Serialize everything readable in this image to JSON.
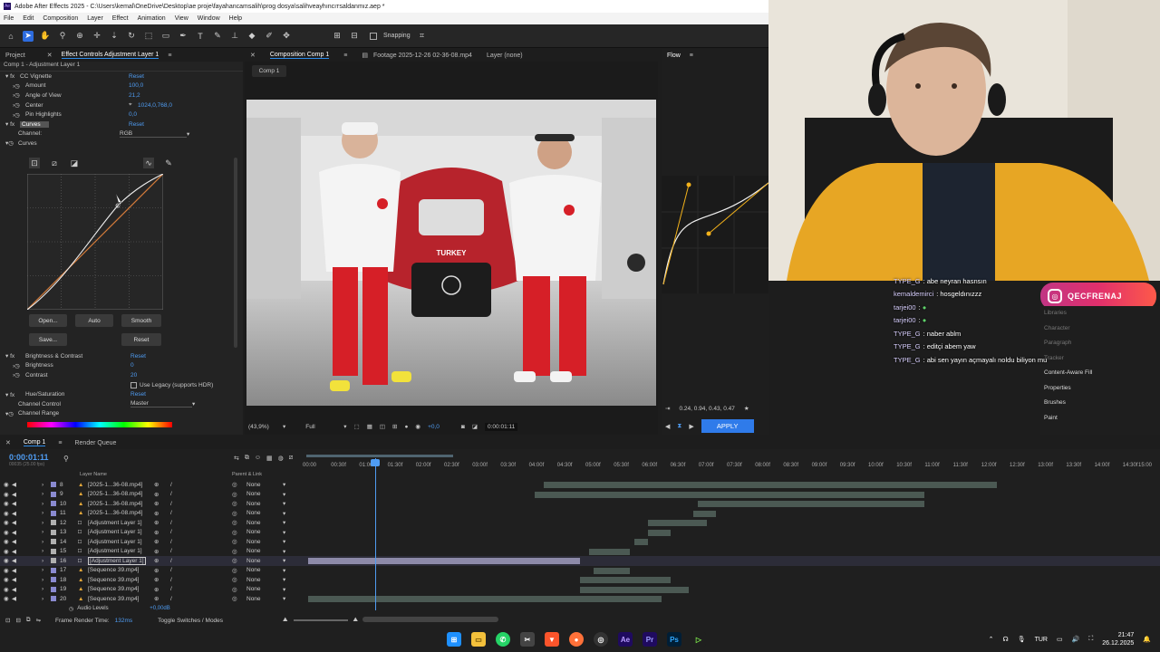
{
  "window": {
    "title": "Adobe After Effects 2025 - C:\\Users\\kemal\\OneDrive\\Desktop\\ae proje\\fayahancamsalih\\prog dosya\\salihveayhıncıтsaldanmız.aep *",
    "menu": [
      "File",
      "Edit",
      "Composition",
      "Layer",
      "Effect",
      "Animation",
      "View",
      "Window",
      "Help"
    ]
  },
  "toolbar": {
    "snapping_label": "Snapping"
  },
  "project_panel": {
    "tabs": [
      "Project",
      "Effect Controls Adjustment Layer 1"
    ],
    "subtitle": "Comp 1 - Adjustment Layer 1",
    "rows": [
      {
        "label": "CC Vignette",
        "value": "Reset"
      },
      {
        "label": "Amount",
        "value": "100,0"
      },
      {
        "label": "Angle of View",
        "value": "21,2"
      },
      {
        "label": "Center",
        "value": "1024,0,768,0"
      },
      {
        "label": "Pin Highlights",
        "value": "0,0"
      },
      {
        "label": "Curves",
        "value": "Reset"
      },
      {
        "label": "Channel:",
        "value": "RGB"
      },
      {
        "label": "Curves",
        "value": ""
      }
    ],
    "curve_buttons": [
      "Open...",
      "Auto",
      "Smooth",
      "Save...",
      "Reset"
    ],
    "rows2": [
      {
        "label": "Brightness & Contrast",
        "value": "Reset"
      },
      {
        "label": "Brightness",
        "value": "0"
      },
      {
        "label": "Contrast",
        "value": "20"
      },
      {
        "label": "Use Legacy (supports HDR)",
        "value": ""
      },
      {
        "label": "Hue/Saturation",
        "value": "Reset"
      },
      {
        "label": "Channel Control",
        "value": "Master"
      },
      {
        "label": "Channel Range",
        "value": ""
      }
    ]
  },
  "comp_panel": {
    "tabs": [
      "Composition Comp 1",
      "Footage 2025-12-26 02-36-08.mp4",
      "Layer (none)"
    ],
    "comp_tab": "Comp 1",
    "zoom": "(43,9%)",
    "resolution": "Full",
    "exposure": "+0,0",
    "timecode": "0:00:01:11"
  },
  "flow_panel": {
    "title": "Flow",
    "values": "0.24, 0.94, 0.43, 0.47",
    "apply_label": "APPLY"
  },
  "right_panel": {
    "items": [
      "Libraries",
      "Character",
      "Paragraph",
      "Tracker",
      "Content-Aware Fill",
      "Properties",
      "Brushes",
      "Paint"
    ]
  },
  "instagram": {
    "handle": "QECFRENAJ"
  },
  "chat": [
    {
      "user": "TYPE_G",
      "msg": "abe neyran hasnsın"
    },
    {
      "user": "kemaldemirci",
      "msg": "hosgeldınızzz"
    },
    {
      "user": "tarjei00",
      "msg": ""
    },
    {
      "user": "tarjei00",
      "msg": ""
    },
    {
      "user": "TYPE_G",
      "msg": "naber ablm"
    },
    {
      "user": "TYPE_G",
      "msg": "editçi abem yaw"
    },
    {
      "user": "TYPE_G",
      "msg": "abi sen yayın açmayalı noldu biliyon mu"
    }
  ],
  "timeline": {
    "tabs": [
      "Comp 1",
      "Render Queue"
    ],
    "timecode": "0:00:01:11",
    "frame_info": "00035 (25.00 fps)",
    "columns": [
      "Layer Name",
      "Parent & Link"
    ],
    "ruler": [
      "00:00",
      "00:30f",
      "01:00f",
      "01:30f",
      "02:00f",
      "02:30f",
      "03:00f",
      "03:30f",
      "04:00f",
      "04:30f",
      "05:00f",
      "05:30f",
      "06:00f",
      "06:30f",
      "07:00f",
      "07:30f",
      "08:00f",
      "08:30f",
      "09:00f",
      "09:30f",
      "10:00f",
      "10:30f",
      "11:00f",
      "11:30f",
      "12:00f",
      "12:30f",
      "13:00f",
      "13:30f",
      "14:00f",
      "14:30f",
      "15:00"
    ],
    "layers": [
      {
        "num": "8",
        "name": "[2025-1...36-08.mp4]",
        "parent": "None"
      },
      {
        "num": "9",
        "name": "[2025-1...36-08.mp4]",
        "parent": "None"
      },
      {
        "num": "10",
        "name": "[2025-1...36-08.mp4]",
        "parent": "None"
      },
      {
        "num": "11",
        "name": "[2025-1...36-08.mp4]",
        "parent": "None"
      },
      {
        "num": "12",
        "name": "[Adjustment Layer 1]",
        "parent": "None"
      },
      {
        "num": "13",
        "name": "[Adjustment Layer 1]",
        "parent": "None"
      },
      {
        "num": "14",
        "name": "[Adjustment Layer 1]",
        "parent": "None"
      },
      {
        "num": "15",
        "name": "[Adjustment Layer 1]",
        "parent": "None"
      },
      {
        "num": "16",
        "name": "[Adjustment Layer 1]",
        "parent": "None"
      },
      {
        "num": "17",
        "name": "[Sequence 39.mp4]",
        "parent": "None"
      },
      {
        "num": "18",
        "name": "[Sequence 39.mp4]",
        "parent": "None"
      },
      {
        "num": "19",
        "name": "[Sequence 39.mp4]",
        "parent": "None"
      },
      {
        "num": "20",
        "name": "[Sequence 39.mp4]",
        "parent": "None"
      }
    ],
    "audio_levels": "Audio Levels",
    "audio_value": "+0,00dB",
    "frame_render_label": "Frame Render Time:",
    "frame_render_value": "132ms",
    "toggle_label": "Toggle Switches / Modes"
  },
  "taskbar": {
    "lang": "TUR",
    "time": "21:47",
    "date": "26.12.2025"
  }
}
